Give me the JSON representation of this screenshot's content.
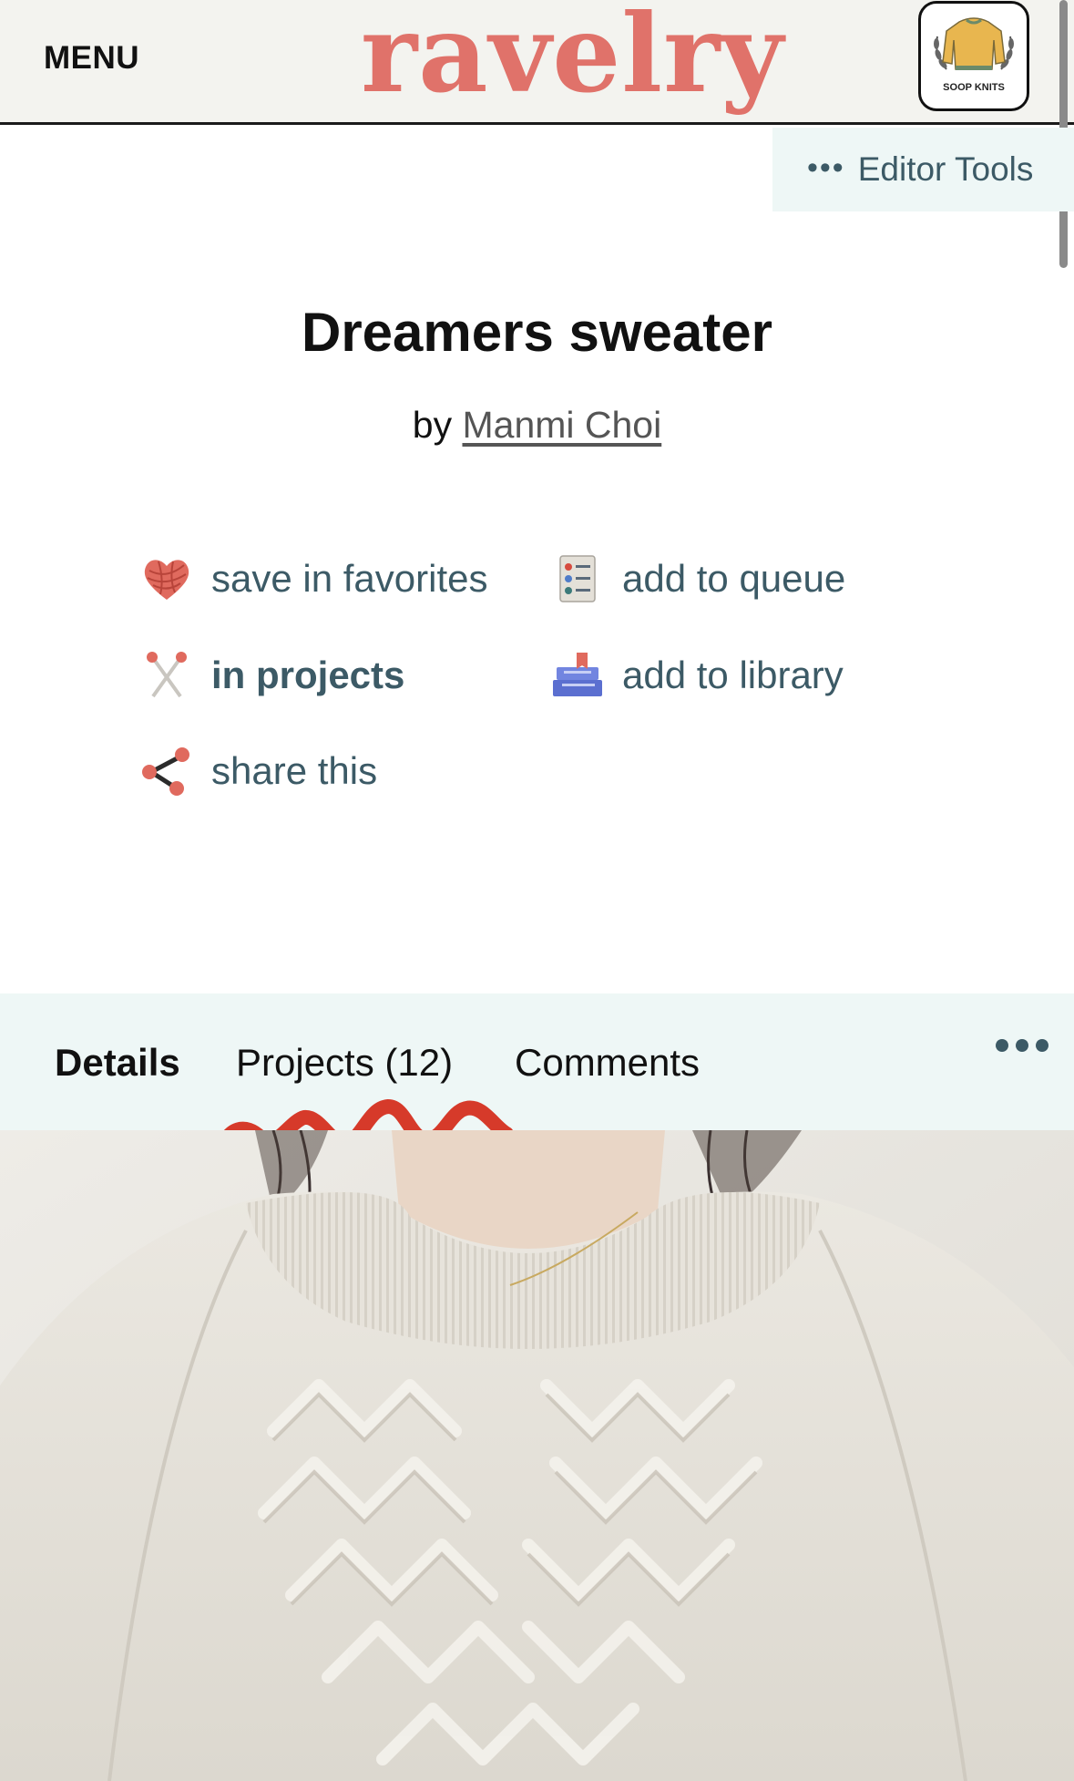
{
  "header": {
    "menu_label": "MENU",
    "logo_text": "ravelry",
    "avatar_label": "SOOP KNITS",
    "logo_color": "#e0726a"
  },
  "editor_tools": {
    "label": "Editor Tools",
    "icon": "ellipsis-icon"
  },
  "pattern": {
    "title": "Dreamers sweater",
    "by_prefix": "by",
    "author": "Manmi Choi"
  },
  "actions": {
    "favorites": {
      "label": "save in favorites",
      "icon": "yarn-heart-icon"
    },
    "queue": {
      "label": "add to queue",
      "icon": "queue-list-icon"
    },
    "projects": {
      "label": "in projects",
      "icon": "knitting-needles-icon"
    },
    "library": {
      "label": "add to library",
      "icon": "books-icon"
    },
    "share": {
      "label": "share this",
      "icon": "share-icon"
    }
  },
  "tabs": {
    "details": "Details",
    "projects": "Projects (12)",
    "comments": "Comments",
    "more_icon": "ellipsis-icon"
  },
  "annotation": {
    "color": "#d63a2a",
    "shape": "red-squiggle-underline"
  },
  "photo": {
    "subject": "cream cable-knit sweater"
  }
}
